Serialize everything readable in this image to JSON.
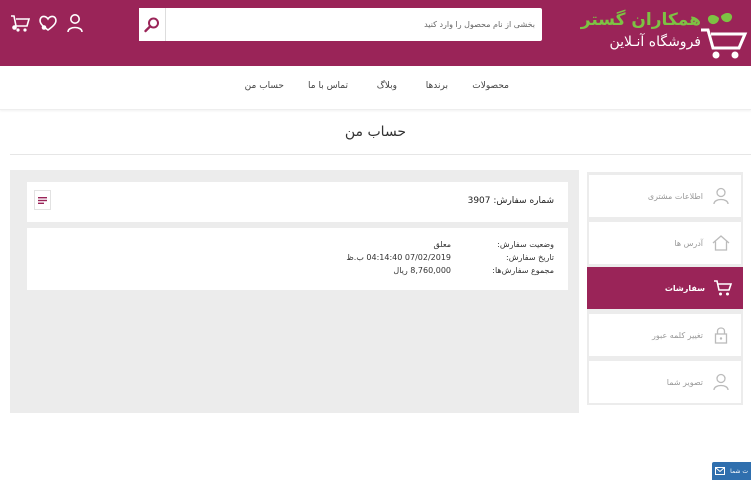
{
  "header": {
    "logo": {
      "brand": "همکاران گستر",
      "subtitle": "فروشگاه آنـلاین"
    },
    "search": {
      "placeholder": "بخشی از نام محصول را وارد کنید"
    },
    "icons": [
      "search-icon",
      "user-icon",
      "heart-icon",
      "cart-icon"
    ]
  },
  "nav": {
    "items": [
      "محصولات",
      "برندها",
      "وبلاگ",
      "تماس با ما",
      "حساب من"
    ]
  },
  "page": {
    "title": "حساب من"
  },
  "order": {
    "number_label": "شماره سفارش: 3907",
    "status_label": "وضعیت سفارش:",
    "status_value": "معلق",
    "date_label": "تاریخ سفارش:",
    "date_value": "07/02/2019 04:14:40 ب.ظ",
    "total_label": "مجموع سفارش‌ها:",
    "total_value": "8,760,000 ریال"
  },
  "sidebar": {
    "items": [
      {
        "label": "اطلاعات مشتری",
        "icon": "user-icon"
      },
      {
        "label": "آدرس ها",
        "icon": "home-icon"
      },
      {
        "label": "سفارشات",
        "icon": "cart-icon",
        "active": true
      },
      {
        "label": "تغییر کلمه عبور",
        "icon": "lock-icon"
      },
      {
        "label": "تصویر شما",
        "icon": "user-icon"
      }
    ]
  },
  "chat": {
    "label": "ت شما"
  },
  "colors": {
    "brand": "#9a2458",
    "logo_green": "#7dc243",
    "chat_blue": "#2f6fae",
    "panel_gray": "#ececec"
  }
}
